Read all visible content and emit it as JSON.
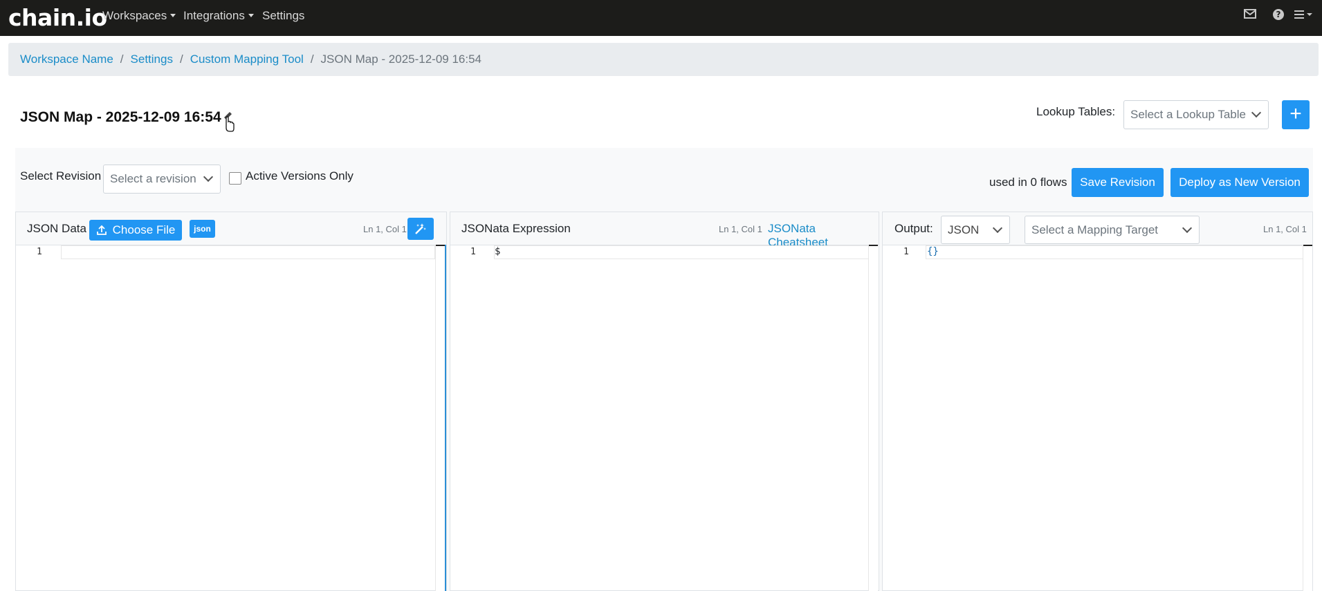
{
  "navbar": {
    "logo": "chain.io",
    "items": [
      "Workspaces",
      "Integrations",
      "Settings"
    ],
    "icons": [
      "mail-icon",
      "help-icon",
      "menu-icon"
    ]
  },
  "breadcrumb": {
    "items": [
      "Workspace Name",
      "Settings",
      "Custom Mapping Tool"
    ],
    "current": "JSON Map - 2025-12-09 16:54"
  },
  "page": {
    "title": "JSON Map - 2025-12-09 16:54",
    "lookup_label": "Lookup Tables:",
    "lookup_placeholder": "Select a Lookup Table",
    "plus": "+"
  },
  "revision": {
    "label": "Select Revision",
    "placeholder": "Select a revision",
    "active_only_label": "Active Versions Only",
    "active_only_checked": false,
    "flows_text": "used in 0 flows",
    "save_label": "Save Revision",
    "deploy_label": "Deploy as New Version"
  },
  "json_panel": {
    "title": "JSON Data",
    "choose_file": "Choose File",
    "badge": "json",
    "lncol": "Ln 1, Col 1",
    "line_number": "1",
    "content": ""
  },
  "jsonata_panel": {
    "title": "JSONata Expression",
    "lncol": "Ln 1, Col 1",
    "cheatsheet": "JSONata Cheatsheet",
    "line_number": "1",
    "content": "$"
  },
  "output_panel": {
    "title": "Output:",
    "format": "JSON",
    "target_placeholder": "Select a Mapping Target",
    "lncol": "Ln 1, Col 1",
    "line_number": "1",
    "content": "{}"
  },
  "colors": {
    "navbar": "#1c1c1a",
    "primary": "#2196f3",
    "link": "#1a8cc8",
    "breadcrumb_bg": "#e9ecef"
  }
}
